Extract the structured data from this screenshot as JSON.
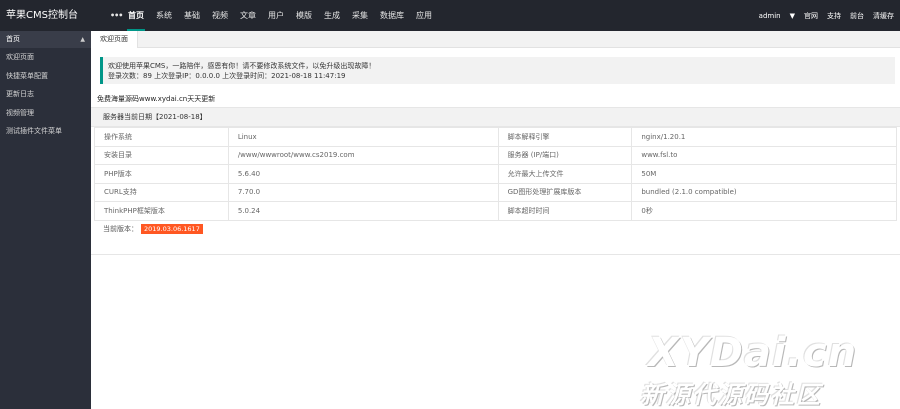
{
  "app": {
    "title": "苹果CMS控制台"
  },
  "topnav": {
    "more": "•••",
    "items": [
      "首页",
      "系统",
      "基础",
      "视频",
      "文章",
      "用户",
      "模版",
      "生成",
      "采集",
      "数据库",
      "应用"
    ]
  },
  "topright": {
    "user": "admin",
    "links": [
      "官网",
      "支持",
      "前台",
      "清缓存"
    ]
  },
  "sidebar": {
    "head": "首页",
    "items": [
      "欢迎页面",
      "快捷菜单配置",
      "更新日志",
      "视频管理",
      "测试插件文件菜单"
    ]
  },
  "tabs": [
    "欢迎页面"
  ],
  "notice": {
    "line1": "欢迎使用苹果CMS，一路陪伴，感恩有你！请不要修改系统文件，以免升级出现故障！",
    "line2": "登录次数：89 上次登录IP：0.0.0.0 上次登录时间：2021-08-18 11:47:19"
  },
  "free_text": "免费海量源码www.xydai.cn天天更新",
  "server_panel": {
    "title": "服务器当前日期【2021-08-18】",
    "rows": [
      [
        "操作系统",
        "Linux",
        "脚本解释引擎",
        "nginx/1.20.1"
      ],
      [
        "安装目录",
        "/www/wwwroot/www.cs2019.com",
        "服务器 (IP/端口)",
        "www.fsl.to"
      ],
      [
        "PHP版本",
        "5.6.40",
        "允许最大上传文件",
        "50M"
      ],
      [
        "CURL支持",
        "7.70.0",
        "GD图形处理扩展库版本",
        "bundled (2.1.0 compatible)"
      ],
      [
        "ThinkPHP框架版本",
        "5.0.24",
        "脚本超时时间",
        "0秒"
      ]
    ],
    "version_label": "当前版本：",
    "version": "2019.03.06.1617"
  },
  "watermark": {
    "line1": "XYDai.cn",
    "line2": "新源代源码社区"
  },
  "colors": {
    "topbar": "#23262e",
    "sidebar": "#2b2f3a",
    "accent": "#009688",
    "badge": "#ff5722"
  }
}
